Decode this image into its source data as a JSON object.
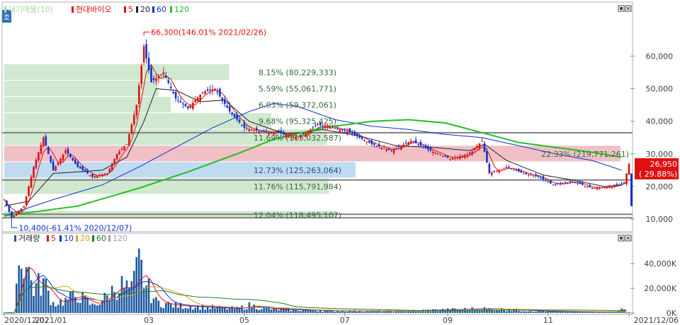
{
  "chart_data": [
    {
      "type": "candlestick",
      "title": "현대바이오",
      "legend": [
        {
          "label": "대기매물(10)",
          "color": "#a8d8a8"
        },
        {
          "label": "현대바이오",
          "color": "#e01010"
        },
        {
          "label": "5",
          "color": "#e01010"
        },
        {
          "label": "20",
          "color": "#202020"
        },
        {
          "label": "60",
          "color": "#1030d0"
        },
        {
          "label": "120",
          "color": "#20c020"
        }
      ],
      "y_ticks": [
        "60,000",
        "50,000",
        "40,000",
        "30,000",
        "20,000",
        "10,000"
      ],
      "y_tick_values": [
        60000,
        50000,
        40000,
        30000,
        20000,
        10000
      ],
      "ylim": [
        7000,
        72000
      ],
      "x_ticks": [
        "2020/12/02",
        "2021/01",
        "03",
        "05",
        "07",
        "09",
        "11",
        "2021/12/06"
      ],
      "x_tick_index": [
        0,
        19,
        59,
        98,
        139,
        181,
        222,
        255
      ],
      "n_bars": 256,
      "current_price": {
        "label": "26,950",
        "change": "( 29.88%)",
        "value": 26950
      },
      "max_annotation": {
        "label": "66,300(146.01% 2021/02/26)",
        "value": 66300,
        "index": 57
      },
      "min_annotation": {
        "label": "10,400(-61.41% 2020/12/07)",
        "value": 10400,
        "index": 3
      },
      "volume_profile": [
        {
          "label": "5.59% (55,061,771)",
          "price_from": 47500,
          "price_to": 52500,
          "fraction": 0.0559
        },
        {
          "label": "6.03% (59,372,061)",
          "price_from": 42500,
          "price_to": 47500,
          "fraction": 0.0603
        },
        {
          "label": "9.68% (95,325,425)",
          "price_from": 37500,
          "price_to": 42500,
          "fraction": 0.0968
        },
        {
          "label": "11.69% (115,032,587)",
          "price_from": 32500,
          "price_to": 37500,
          "fraction": 0.1169
        },
        {
          "label": "22.33% (219,771,261)",
          "price_from": 27500,
          "price_to": 32500,
          "fraction": 0.2233,
          "highlight": "resistance"
        },
        {
          "label": "12.73% (125,263,064)",
          "price_from": 22500,
          "price_to": 27500,
          "fraction": 0.1273,
          "highlight": "current"
        },
        {
          "label": "11.76% (115,791,984)",
          "price_from": 17500,
          "price_to": 22500,
          "fraction": 0.1176
        },
        {
          "label": "12.04% (118,495,107)",
          "price_from": 10000,
          "price_to": 12500,
          "fraction": 0.1204
        },
        {
          "label": "8.15% (80,229,333)",
          "price_from": 52500,
          "price_to": 57500,
          "fraction": 0.0815
        }
      ],
      "horizontal_lines": [
        36500,
        22000,
        11500,
        10400
      ],
      "key_prices": [
        {
          "index": 0,
          "close": 16000
        },
        {
          "index": 3,
          "close": 10400
        },
        {
          "index": 8,
          "close": 14000
        },
        {
          "index": 12,
          "close": 26000
        },
        {
          "index": 16,
          "close": 35000
        },
        {
          "index": 20,
          "close": 25000
        },
        {
          "index": 25,
          "close": 31000
        },
        {
          "index": 30,
          "close": 26000
        },
        {
          "index": 36,
          "close": 23000
        },
        {
          "index": 42,
          "close": 24000
        },
        {
          "index": 46,
          "close": 30000
        },
        {
          "index": 50,
          "close": 33000
        },
        {
          "index": 54,
          "close": 45000
        },
        {
          "index": 57,
          "close": 63000
        },
        {
          "index": 60,
          "close": 52000
        },
        {
          "index": 65,
          "close": 55000
        },
        {
          "index": 70,
          "close": 47000
        },
        {
          "index": 75,
          "close": 44000
        },
        {
          "index": 81,
          "close": 49000
        },
        {
          "index": 86,
          "close": 50000
        },
        {
          "index": 92,
          "close": 43000
        },
        {
          "index": 98,
          "close": 38000
        },
        {
          "index": 104,
          "close": 37000
        },
        {
          "index": 112,
          "close": 36500
        },
        {
          "index": 120,
          "close": 35000
        },
        {
          "index": 128,
          "close": 39000
        },
        {
          "index": 140,
          "close": 37000
        },
        {
          "index": 150,
          "close": 33000
        },
        {
          "index": 158,
          "close": 31000
        },
        {
          "index": 166,
          "close": 34000
        },
        {
          "index": 174,
          "close": 31000
        },
        {
          "index": 182,
          "close": 28500
        },
        {
          "index": 190,
          "close": 30000
        },
        {
          "index": 195,
          "close": 34000
        },
        {
          "index": 198,
          "close": 24000
        },
        {
          "index": 205,
          "close": 26000
        },
        {
          "index": 212,
          "close": 24000
        },
        {
          "index": 218,
          "close": 23000
        },
        {
          "index": 224,
          "close": 20500
        },
        {
          "index": 232,
          "close": 21500
        },
        {
          "index": 240,
          "close": 19500
        },
        {
          "index": 248,
          "close": 20000
        },
        {
          "index": 253,
          "close": 21000
        },
        {
          "index": 255,
          "close": 26950
        }
      ],
      "ma_lines": [
        {
          "name": "5",
          "color": "#e01010",
          "points": []
        },
        {
          "name": "20",
          "color": "#202020",
          "points": [
            [
              0,
              14000
            ],
            [
              10,
              15500
            ],
            [
              20,
              24000
            ],
            [
              30,
              24500
            ],
            [
              40,
              25000
            ],
            [
              50,
              29000
            ],
            [
              57,
              40000
            ],
            [
              62,
              50000
            ],
            [
              70,
              49500
            ],
            [
              80,
              46000
            ],
            [
              90,
              46500
            ],
            [
              100,
              40000
            ],
            [
              115,
              36000
            ],
            [
              130,
              37500
            ],
            [
              145,
              35500
            ],
            [
              160,
              32500
            ],
            [
              175,
              32000
            ],
            [
              190,
              31000
            ],
            [
              196,
              33000
            ],
            [
              205,
              28000
            ],
            [
              220,
              23500
            ],
            [
              232,
              22000
            ],
            [
              245,
              20000
            ],
            [
              252,
              20500
            ]
          ]
        },
        {
          "name": "60",
          "color": "#1030d0",
          "points": [
            [
              0,
              11000
            ],
            [
              20,
              16000
            ],
            [
              40,
              20500
            ],
            [
              55,
              26000
            ],
            [
              70,
              32000
            ],
            [
              85,
              38000
            ],
            [
              100,
              43000
            ],
            [
              110,
              45500
            ],
            [
              120,
              44500
            ],
            [
              135,
              40500
            ],
            [
              150,
              38500
            ],
            [
              165,
              37500
            ],
            [
              180,
              36000
            ],
            [
              195,
              35000
            ],
            [
              210,
              32500
            ],
            [
              225,
              30000
            ],
            [
              240,
              28000
            ],
            [
              252,
              25000
            ]
          ]
        },
        {
          "name": "120",
          "color": "#20c020",
          "points": [
            [
              0,
              11000
            ],
            [
              30,
              14000
            ],
            [
              55,
              19500
            ],
            [
              75,
              24500
            ],
            [
              95,
              30000
            ],
            [
              110,
              34500
            ],
            [
              130,
              38000
            ],
            [
              150,
              40000
            ],
            [
              165,
              40500
            ],
            [
              180,
              39500
            ],
            [
              195,
              36500
            ],
            [
              210,
              33500
            ],
            [
              225,
              32000
            ],
            [
              240,
              30500
            ],
            [
              252,
              29000
            ]
          ]
        }
      ]
    },
    {
      "type": "bar",
      "title": "거래량",
      "legend": [
        {
          "label": "거래량",
          "color": "#1e5aa0"
        },
        {
          "label": "5",
          "color": "#e01010"
        },
        {
          "label": "10",
          "color": "#1030d0"
        },
        {
          "label": "20",
          "color": "#e0a020"
        },
        {
          "label": "60",
          "color": "#208020"
        },
        {
          "label": "120",
          "color": "#a0a0a0"
        }
      ],
      "y_ticks": [
        "40,000K",
        "20,000K",
        "0K"
      ],
      "y_tick_values": [
        40000,
        20000,
        0
      ],
      "ylim": [
        0,
        55000
      ],
      "unit": "K",
      "key_volumes": [
        {
          "index": 5,
          "value": 26000
        },
        {
          "index": 7,
          "value": 48000
        },
        {
          "index": 9,
          "value": 38000
        },
        {
          "index": 12,
          "value": 20000
        },
        {
          "index": 16,
          "value": 25000
        },
        {
          "index": 20,
          "value": 8000
        },
        {
          "index": 25,
          "value": 10000
        },
        {
          "index": 30,
          "value": 15000
        },
        {
          "index": 36,
          "value": 6000
        },
        {
          "index": 42,
          "value": 13000
        },
        {
          "index": 45,
          "value": 20000
        },
        {
          "index": 48,
          "value": 22000
        },
        {
          "index": 52,
          "value": 18000
        },
        {
          "index": 55,
          "value": 40000
        },
        {
          "index": 58,
          "value": 22000
        },
        {
          "index": 62,
          "value": 9000
        },
        {
          "index": 70,
          "value": 6000
        },
        {
          "index": 80,
          "value": 5000
        },
        {
          "index": 95,
          "value": 3500
        },
        {
          "index": 100,
          "value": 6000
        },
        {
          "index": 110,
          "value": 3000
        },
        {
          "index": 130,
          "value": 2000
        },
        {
          "index": 160,
          "value": 1500
        },
        {
          "index": 196,
          "value": 3500
        },
        {
          "index": 220,
          "value": 1500
        },
        {
          "index": 250,
          "value": 800
        },
        {
          "index": 253,
          "value": 5000
        }
      ]
    }
  ]
}
